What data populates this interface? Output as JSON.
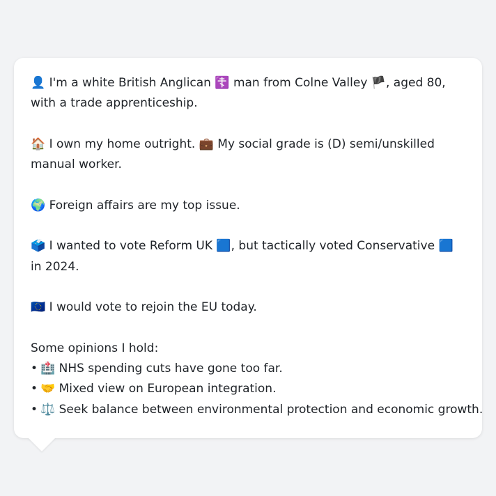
{
  "profile": {
    "intro": {
      "icon": "👤",
      "text_before": " I'm a white British Anglican ",
      "religion_icon": "☦️",
      "text_middle": " man from Colne Valley ",
      "flag_icon": "🏴",
      "text_after": ", aged 80, with a trade apprenticeship."
    },
    "home": {
      "icon": "🏠",
      "text_before": " I own my home outright. ",
      "work_icon": "💼",
      "text_after": " My social grade is (D) semi/unskilled manual worker."
    },
    "issue": {
      "icon": "🌍",
      "text": " Foreign affairs are my top issue."
    },
    "vote": {
      "icon": "🗳️",
      "text_before": " I wanted to vote Reform UK ",
      "party1_icon": "🟦",
      "text_middle": ", but tactically voted Conservative ",
      "party2_icon": "🟦",
      "text_after": " in 2024."
    },
    "eu": {
      "icon": "🇪🇺",
      "text": " I would vote to rejoin the EU today."
    },
    "opinions": {
      "heading": "Some opinions I hold:",
      "bullet": "•",
      "items": [
        {
          "icon": "🏥",
          "text": " NHS spending cuts have gone too far."
        },
        {
          "icon": "🤝",
          "text": " Mixed view on European integration."
        },
        {
          "icon": "⚖️",
          "text": " Seek balance between environmental protection and economic growth."
        }
      ]
    }
  },
  "colors": {
    "background": "#f2f3f5",
    "bubble": "#ffffff",
    "text": "#1f2328"
  }
}
